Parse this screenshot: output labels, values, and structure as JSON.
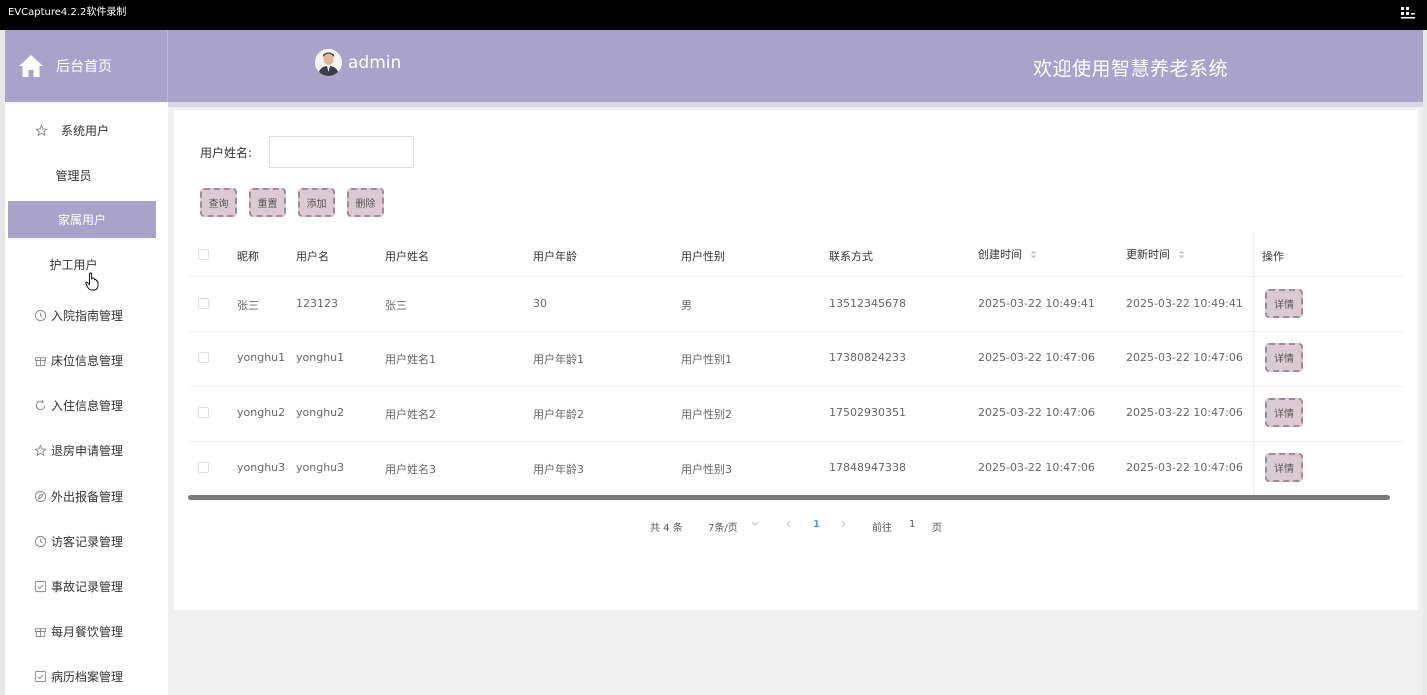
{
  "window": {
    "title": "EVCapture4.2.2软件录制"
  },
  "header": {
    "home_label": "后台首页",
    "username": "admin",
    "welcome": "欢迎使用智慧养老系统",
    "bg_color": "#a9a3cc"
  },
  "sidebar": {
    "items": [
      {
        "label": "系统用户",
        "icon": "star-icon"
      },
      {
        "label": "管理员"
      },
      {
        "label": "家属用户",
        "active": true
      },
      {
        "label": "护工用户"
      },
      {
        "label": "入院指南管理",
        "icon": "clock-icon"
      },
      {
        "label": "床位信息管理",
        "icon": "gift-icon"
      },
      {
        "label": "入住信息管理",
        "icon": "refresh-icon"
      },
      {
        "label": "退房申请管理",
        "icon": "star-icon"
      },
      {
        "label": "外出报备管理",
        "icon": "compass-icon"
      },
      {
        "label": "访客记录管理",
        "icon": "clock-icon"
      },
      {
        "label": "事故记录管理",
        "icon": "checkbox-icon"
      },
      {
        "label": "每月餐饮管理",
        "icon": "gift-icon"
      },
      {
        "label": "病历档案管理",
        "icon": "checkbox-icon"
      }
    ]
  },
  "search": {
    "label": "用户姓名:",
    "value": "",
    "placeholder": ""
  },
  "buttons": {
    "query": "查询",
    "reset": "重置",
    "add": "添加",
    "delete": "删除"
  },
  "table": {
    "columns": [
      "昵称",
      "用户名",
      "用户姓名",
      "用户年龄",
      "用户性别",
      "联系方式",
      "创建时间",
      "更新时间",
      "操作"
    ],
    "rows": [
      [
        "张三",
        "123123",
        "张三",
        "30",
        "男",
        "13512345678",
        "2025-03-22 10:49:41",
        "2025-03-22 10:49:41"
      ],
      [
        "yonghu1",
        "yonghu1",
        "用户姓名1",
        "用户年龄1",
        "用户性别1",
        "17380824233",
        "2025-03-22 10:47:06",
        "2025-03-22 10:47:06"
      ],
      [
        "yonghu2",
        "yonghu2",
        "用户姓名2",
        "用户年龄2",
        "用户性别2",
        "17502930351",
        "2025-03-22 10:47:06",
        "2025-03-22 10:47:06"
      ],
      [
        "yonghu3",
        "yonghu3",
        "用户姓名3",
        "用户年龄3",
        "用户性别3",
        "17848947338",
        "2025-03-22 10:47:06",
        "2025-03-22 10:47:06"
      ]
    ],
    "detail_label": "详情"
  },
  "pagination": {
    "total": "共 4 条",
    "page_size": "7条/页",
    "current_page": "1",
    "goto_prefix": "前往",
    "goto_value": "1",
    "goto_suffix": "页"
  }
}
